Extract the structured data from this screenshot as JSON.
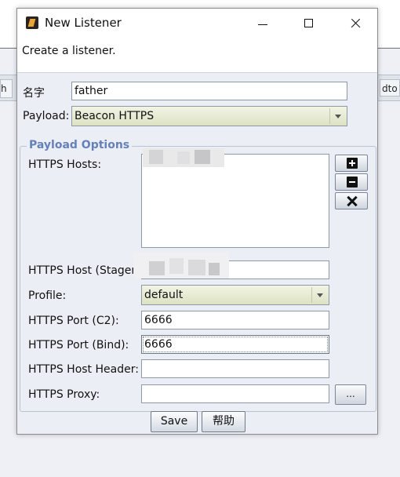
{
  "background": {
    "tab_left_label": "h",
    "tab_right_label": "dto"
  },
  "window": {
    "title": "New Listener",
    "description": "Create a listener."
  },
  "form": {
    "name_label": "名字",
    "name_value": "father",
    "payload_label": "Payload:",
    "payload_value": "Beacon HTTPS"
  },
  "payload_options": {
    "group_title": "Payload Options",
    "https_hosts_label": "HTTPS Hosts:",
    "stager_host_label": "HTTPS Host (Stager",
    "stager_host_value": "",
    "profile_label": "Profile:",
    "profile_value": "default",
    "port_c2_label": "HTTPS Port (C2):",
    "port_c2_value": "6666",
    "port_bind_label": "HTTPS Port (Bind):",
    "port_bind_value": "6666",
    "host_header_label": "HTTPS Host Header:",
    "host_header_value": "",
    "proxy_label": "HTTPS Proxy:",
    "proxy_value": "",
    "proxy_button_label": "..."
  },
  "buttons": {
    "save_label": "Save",
    "help_label": "帮助"
  },
  "colors": {
    "group_title": "#6581b8",
    "select_bg": "#dde2c4",
    "content_bg": "#ebeef5"
  },
  "icons": {
    "add": "plus-square-icon",
    "remove": "minus-square-icon",
    "clear": "x-icon"
  }
}
